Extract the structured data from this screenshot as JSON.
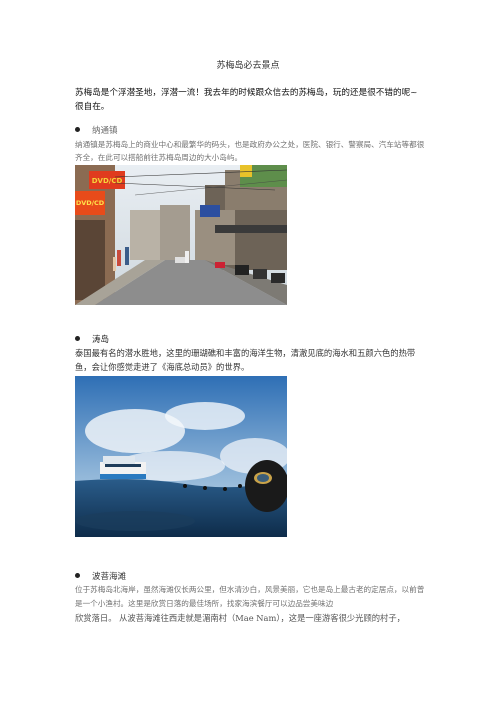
{
  "doc": {
    "title": "苏梅岛必去景点",
    "intro": "苏梅岛是个浮潜圣地，浮潜一流！我去年的时候跟众信去的苏梅岛，玩的还是很不错的呢~很自在。"
  },
  "sections": [
    {
      "heading": "纳通镇",
      "body": "纳通镇是苏梅岛上的商业中心和最繁华的码头，也是政府办公之处，医院、银行、警察局、汽车站等都很齐全，在此可以搭船前往苏梅岛周边的大小岛屿。",
      "photo_signs": [
        "DVD/CD",
        "DVD/CD"
      ]
    },
    {
      "heading": "涛岛",
      "body": "泰国最有名的潜水胜地，这里的珊瑚礁和丰富的海洋生物，清澈见底的海水和五颜六色的热带鱼，会让你感觉走进了《海底总动员》的世界。"
    },
    {
      "heading": "波菩海滩",
      "body_line1": "位于苏梅岛北海岸，虽然海滩仅长两公里，但水清沙白，风景美丽，它也是岛上最古老的定居点，以前曾是一个小渔村。这里是欣赏日落的最佳场所，找家海滨餐厅可以边品尝美味边",
      "body_line2": "欣赏落日。  从波菩海滩往西走就是湄南村（Mae Nam），这是一座游客很少光顾的村子，"
    }
  ]
}
